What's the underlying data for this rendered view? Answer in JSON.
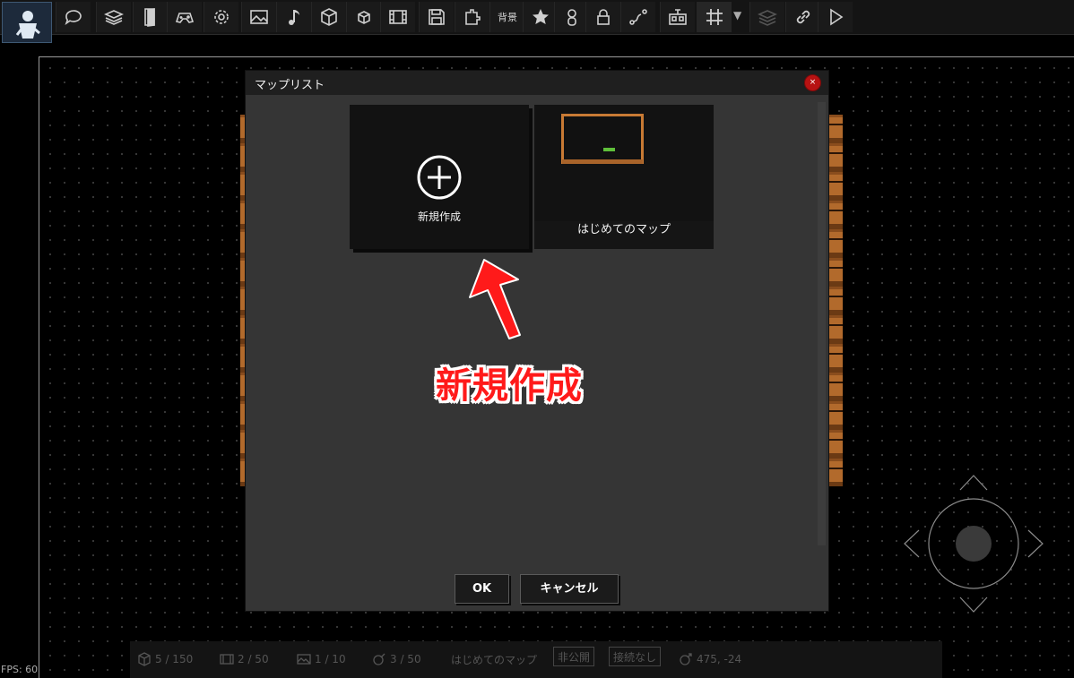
{
  "toolbar": {
    "tools": [
      {
        "icon": "speech-bubble-icon"
      },
      {
        "icon": "layers-stack-icon"
      },
      {
        "icon": "door-icon"
      },
      {
        "icon": "gamepad-icon"
      },
      {
        "icon": "gear-icon"
      },
      {
        "icon": "image-icon"
      },
      {
        "icon": "music-note-icon"
      },
      {
        "icon": "cube-icon"
      },
      {
        "icon": "small-cube-icon"
      },
      {
        "icon": "film-icon"
      },
      {
        "icon": "save-icon"
      },
      {
        "icon": "plugin-icon"
      },
      {
        "icon": "background-text",
        "label": "背景"
      },
      {
        "icon": "star-icon"
      },
      {
        "icon": "person-icon"
      },
      {
        "icon": "lock-icon"
      },
      {
        "icon": "path-icon"
      },
      {
        "icon": "robot-icon"
      },
      {
        "icon": "grid-icon"
      },
      {
        "icon": "layers-icon"
      },
      {
        "icon": "link-icon"
      },
      {
        "icon": "play-icon"
      }
    ],
    "dropdown_caret": "▼"
  },
  "dialog": {
    "title": "マップリスト",
    "close_label": "×",
    "new_card_label": "新規作成",
    "map_card_label": "はじめてのマップ",
    "ok_label": "OK",
    "cancel_label": "キャンセル"
  },
  "annotation": {
    "text": "新規作成",
    "color": "#ff1a1a"
  },
  "status": {
    "objects": "5 / 150",
    "scenes": "2 / 50",
    "images": "1 / 10",
    "switches": "3 / 50",
    "map_name": "はじめてのマップ",
    "visibility": "非公開",
    "connection": "接続なし",
    "coords": "475, -24"
  },
  "fps": "FPS: 60",
  "colors": {
    "toolbar_bg": "#141414",
    "dialog_bg": "#353535",
    "accent_red": "#b71212"
  }
}
